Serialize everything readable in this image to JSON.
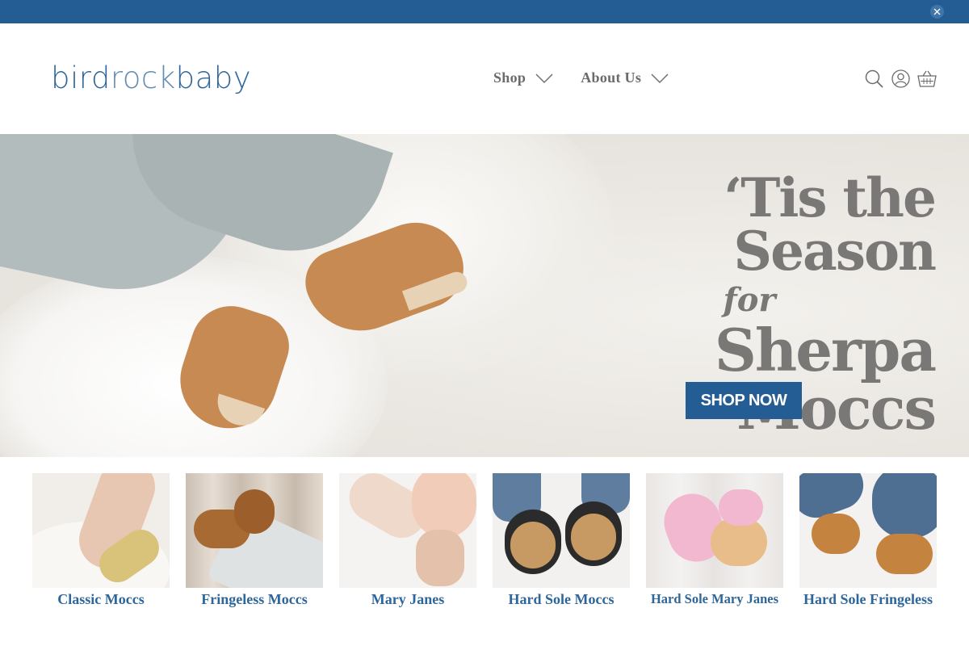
{
  "brand": {
    "logo_part1": "bird",
    "logo_part2": "rock",
    "logo_part3": "baby"
  },
  "colors": {
    "primary": "#245d94",
    "nav_text": "#6b6b6b",
    "label_blue": "#2f6699"
  },
  "nav": [
    {
      "label": "Shop"
    },
    {
      "label": "About Us"
    }
  ],
  "header_icons": [
    "search-icon",
    "account-icon",
    "cart-icon"
  ],
  "hero": {
    "line1": "‘Tis the Season",
    "line2": "for",
    "line3": "Sherpa Moccs",
    "cta": "SHOP NOW"
  },
  "categories": [
    {
      "label": "Classic Moccs"
    },
    {
      "label": "Fringeless Moccs"
    },
    {
      "label": "Mary Janes"
    },
    {
      "label": "Hard Sole Moccs"
    },
    {
      "label": "Hard Sole Mary Janes"
    },
    {
      "label": "Hard Sole Fringeless"
    }
  ]
}
